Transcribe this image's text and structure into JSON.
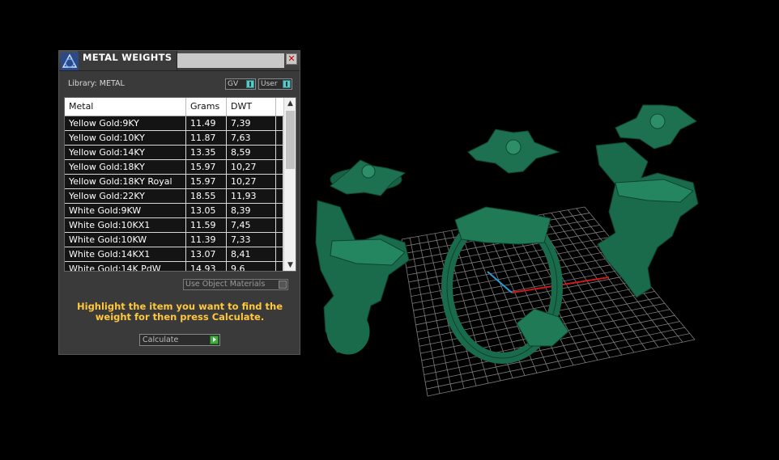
{
  "window": {
    "title": "METAL WEIGHTS",
    "close_icon": "close-icon"
  },
  "library": {
    "label": "Library: METAL"
  },
  "toggles": {
    "gv": "GV",
    "user": "User"
  },
  "table": {
    "columns": [
      "Metal",
      "Grams",
      "DWT"
    ],
    "rows": [
      [
        "Yellow Gold:9KY",
        "11.49",
        "7,39"
      ],
      [
        "Yellow Gold:10KY",
        "11.87",
        "7,63"
      ],
      [
        "Yellow Gold:14KY",
        "13.35",
        "8,59"
      ],
      [
        "Yellow Gold:18KY",
        "15.97",
        "10,27"
      ],
      [
        "Yellow Gold:18KY Royal",
        "15.97",
        "10,27"
      ],
      [
        "Yellow Gold:22KY",
        "18.55",
        "11,93"
      ],
      [
        "White Gold:9KW",
        "13.05",
        "8,39"
      ],
      [
        "White Gold:10KX1",
        "11.59",
        "7,45"
      ],
      [
        "White Gold:10KW",
        "11.39",
        "7,33"
      ],
      [
        "White Gold:14KX1",
        "13.07",
        "8,41"
      ],
      [
        "White Gold:14K PdW",
        "14.93",
        "9,6"
      ]
    ]
  },
  "use_object_materials": "Use Object Materials",
  "hint": "Highlight the item you want to find the weight for then press Calculate.",
  "calculate": {
    "label": "Calculate"
  },
  "colors": {
    "accent_text": "#ffc83d",
    "model_green": "#1f7a55",
    "grid": "#8a8a8a",
    "panel_bg": "#3a3a3a"
  }
}
